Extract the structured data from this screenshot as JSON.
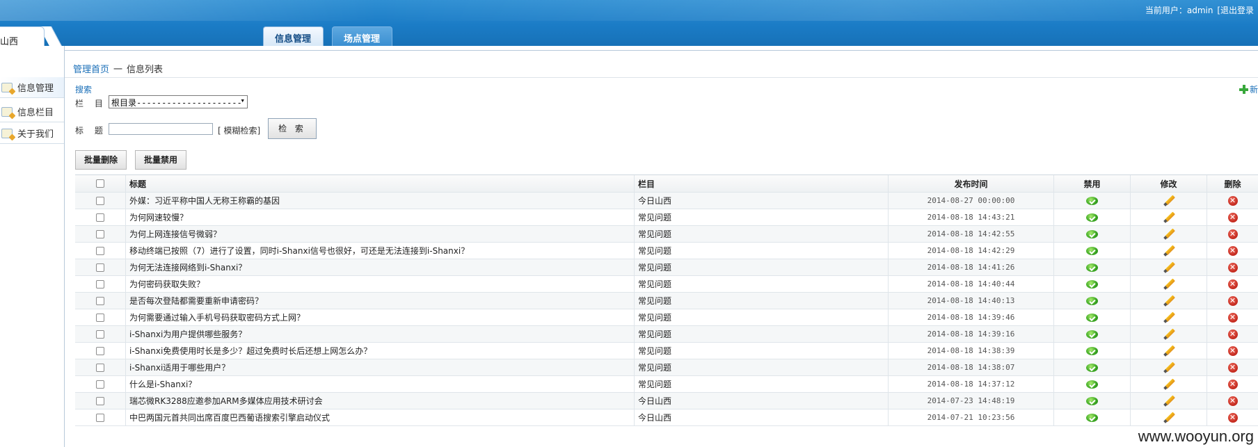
{
  "header": {
    "user_label": "当前用户：admin",
    "logout_label": "[退出登录"
  },
  "site_tab": {
    "label": "山西"
  },
  "nav_tabs": [
    {
      "label": "信息管理",
      "active": true
    },
    {
      "label": "场点管理",
      "active": false
    }
  ],
  "sidebar": {
    "items": [
      {
        "label": "信息管理",
        "icon": "folder-pencil-icon"
      },
      {
        "label": "信息栏目",
        "icon": "folder-pencil-icon"
      },
      {
        "label": "关于我们",
        "icon": "folder-pencil-icon"
      }
    ]
  },
  "breadcrumb": {
    "home": "管理首页",
    "sep": "一",
    "current": "信息列表"
  },
  "search_panel": {
    "search_link": "搜索",
    "add_link": "新",
    "column_label": "栏 目：",
    "column_selected": "根目录---------------------",
    "title_label": "标 题：",
    "title_value": "",
    "fuzzy_label": "[ 模糊检索]",
    "search_button": "检 索"
  },
  "batch": {
    "delete": "批量删除",
    "disable": "批量禁用"
  },
  "colors": {
    "header": "#1b7cc6",
    "link": "#1a6fb8"
  },
  "table": {
    "headers": {
      "title": "标题",
      "column": "栏目",
      "time": "发布时间",
      "disable": "禁用",
      "edit": "修改",
      "delete": "删除"
    },
    "rows": [
      {
        "title": "外媒：习近平称中国人无称王称霸的基因",
        "column": "今日山西",
        "time": "2014-08-27 00:00:00"
      },
      {
        "title": "为何网速较慢？",
        "column": "常见问题",
        "time": "2014-08-18 14:43:21"
      },
      {
        "title": "为何上网连接信号微弱？",
        "column": "常见问题",
        "time": "2014-08-18 14:42:55"
      },
      {
        "title": "移动终端已按照（7）进行了设置，同时i-Shanxi信号也很好，可还是无法连接到i-Shanxi？",
        "column": "常见问题",
        "time": "2014-08-18 14:42:29"
      },
      {
        "title": "为何无法连接网络到i-Shanxi？",
        "column": "常见问题",
        "time": "2014-08-18 14:41:26"
      },
      {
        "title": "为何密码获取失败？",
        "column": "常见问题",
        "time": "2014-08-18 14:40:44"
      },
      {
        "title": "是否每次登陆都需要重新申请密码？",
        "column": "常见问题",
        "time": "2014-08-18 14:40:13"
      },
      {
        "title": "为何需要通过输入手机号码获取密码方式上网？",
        "column": "常见问题",
        "time": "2014-08-18 14:39:46"
      },
      {
        "title": "i-Shanxi为用户提供哪些服务？",
        "column": "常见问题",
        "time": "2014-08-18 14:39:16"
      },
      {
        "title": "i-Shanxi免费使用时长是多少？超过免费时长后还想上网怎么办？",
        "column": "常见问题",
        "time": "2014-08-18 14:38:39"
      },
      {
        "title": "i-Shanxi适用于哪些用户？",
        "column": "常见问题",
        "time": "2014-08-18 14:38:07"
      },
      {
        "title": "什么是i-Shanxi？",
        "column": "常见问题",
        "time": "2014-08-18 14:37:12"
      },
      {
        "title": "瑞芯微RK3288应邀参加ARM多媒体应用技术研讨会",
        "column": "今日山西",
        "time": "2014-07-23 14:48:19"
      },
      {
        "title": "中巴两国元首共同出席百度巴西葡语搜索引擎启动仪式",
        "column": "今日山西",
        "time": "2014-07-21 10:23:56"
      }
    ]
  },
  "watermark": "www.wooyun.org"
}
